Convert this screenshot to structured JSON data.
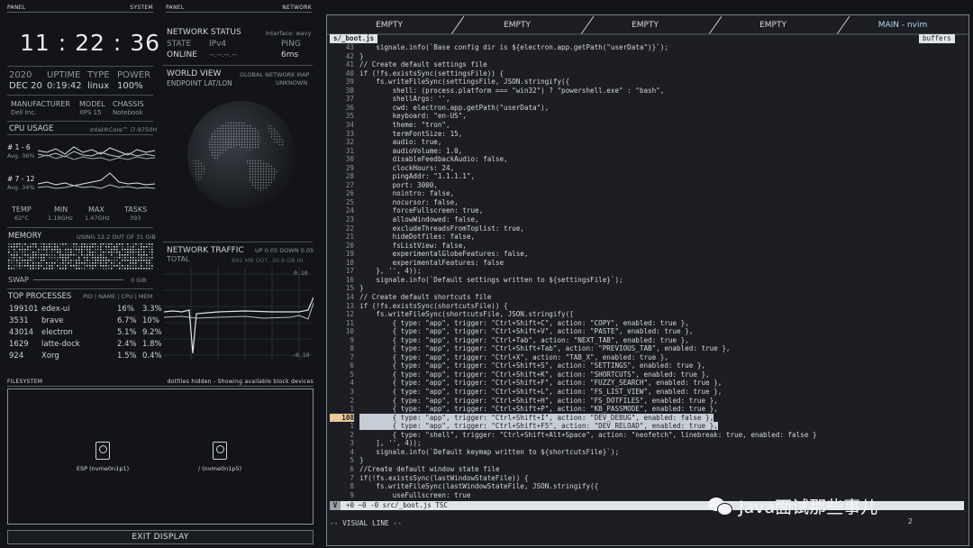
{
  "left_panel": {
    "header_left": "PANEL",
    "header_right": "SYSTEM",
    "clock": "11 : 22 : 36",
    "date_year": "2020",
    "date_day": "DEC 20",
    "uptime_label": "UPTIME",
    "uptime_value": "0:19:42",
    "type_label": "TYPE",
    "type_value": "linux",
    "power_label": "POWER",
    "power_value": "100%",
    "manufacturer_label": "MANUFACTURER",
    "manufacturer_value": "Dell Inc.",
    "model_label": "MODEL",
    "model_value": "XPS 15",
    "chassis_label": "CHASSIS",
    "chassis_value": "Notebook",
    "cpu_usage_label": "CPU USAGE",
    "cpu_model": "Intel®Core™ i7-9750H",
    "cpu_group1": "# 1 - 6",
    "cpu_group1_avg": "Avg. 36%",
    "cpu_group2": "# 7 - 12",
    "cpu_group2_avg": "Avg. 34%",
    "temp_label": "TEMP",
    "temp_value": "62°C",
    "min_label": "MIN",
    "min_value": "1.19GHz",
    "max_label": "MAX",
    "max_value": "1.47GHz",
    "tasks_label": "TASKS",
    "tasks_value": "393",
    "memory_label": "MEMORY",
    "memory_usage": "USING 12.2 OUT OF 31 GiB",
    "swap_label": "SWAP",
    "swap_value": "0 GiB",
    "top_processes_label": "TOP PROCESSES",
    "top_processes_cols": "PID | NAME | CPU | MEM",
    "processes": [
      {
        "pid": "199101",
        "name": "edex-ui",
        "cpu": "16%",
        "mem": "3.3%"
      },
      {
        "pid": "3531",
        "name": "brave",
        "cpu": "6.7%",
        "mem": "10%"
      },
      {
        "pid": "43014",
        "name": "electron",
        "cpu": "5.1%",
        "mem": "9.2%"
      },
      {
        "pid": "1629",
        "name": "latte-dock",
        "cpu": "2.4%",
        "mem": "1.8%"
      },
      {
        "pid": "924",
        "name": "Xorg",
        "cpu": "1.5%",
        "mem": "0.4%"
      }
    ]
  },
  "network_panel": {
    "header_left": "PANEL",
    "header_right": "NETWORK",
    "status_label": "NETWORK STATUS",
    "interface": "Interface: wavy",
    "state_label": "STATE",
    "ipv_label": "IPv4",
    "ping_label": "PING",
    "state_value": "ONLINE",
    "ipv_value": "--.--.--.--",
    "ping_value": "6ms",
    "world_view_label": "WORLD VIEW",
    "global_map_label": "GLOBAL NETWORK MAP",
    "endpoint_label": "ENDPOINT LAT/LON",
    "endpoint_value": "UNKNOWN",
    "traffic_label": "NETWORK TRAFFIC",
    "traffic_rate": "UP 0.05 DOWN 0.05",
    "total_label": "TOTAL",
    "total_value": "842 MB OUT, 30.9 GB IN",
    "scale_top": "0.10",
    "scale_bottom": "-0.10"
  },
  "filesystem": {
    "header_left": "FILESYSTEM",
    "header_right": "dotfiles hidden - Showing available block devices",
    "devices": [
      {
        "label": "ESP (nvme0n1p1)"
      },
      {
        "label": "/ (nvme0n1p5)"
      }
    ],
    "exit_button": "EXIT DISPLAY"
  },
  "terminal": {
    "tabs": [
      "EMPTY",
      "EMPTY",
      "EMPTY",
      "EMPTY",
      "MAIN - nvim"
    ],
    "file_tab": "s/_boot.js",
    "buffers_label": "buffers",
    "status_mode": "V",
    "status_info": "+0 ~0 -0  src/_boot.js  TSC",
    "status_right": "2",
    "command_line": "-- VISUAL LINE --",
    "watermark": "Java面试那些事儿",
    "lines": [
      {
        "n": "43",
        "t": "    signale.info(`Base config dir is ${electron.app.getPath(\"userData\")}`);"
      },
      {
        "n": "42",
        "t": "}"
      },
      {
        "n": "41",
        "t": "// Create default settings file"
      },
      {
        "n": "40",
        "t": "if (!fs.existsSync(settingsFile)) {"
      },
      {
        "n": "39",
        "t": "    fs.writeFileSync(settingsFile, JSON.stringify({"
      },
      {
        "n": "38",
        "t": "        shell: (process.platform === \"win32\") ? \"powershell.exe\" : \"bash\","
      },
      {
        "n": "37",
        "t": "        shellArgs: '',"
      },
      {
        "n": "36",
        "t": "        cwd: electron.app.getPath(\"userData\"),"
      },
      {
        "n": "35",
        "t": "        keyboard: \"en-US\","
      },
      {
        "n": "34",
        "t": "        theme: \"tron\","
      },
      {
        "n": "33",
        "t": "        termFontSize: 15,"
      },
      {
        "n": "32",
        "t": "        audio: true,"
      },
      {
        "n": "31",
        "t": "        audioVolume: 1.0,"
      },
      {
        "n": "30",
        "t": "        disableFeedbackAudio: false,"
      },
      {
        "n": "29",
        "t": "        clockHours: 24,"
      },
      {
        "n": "28",
        "t": "        pingAddr: \"1.1.1.1\","
      },
      {
        "n": "27",
        "t": "        port: 3000,"
      },
      {
        "n": "26",
        "t": "        nointro: false,"
      },
      {
        "n": "25",
        "t": "        nocursor: false,"
      },
      {
        "n": "24",
        "t": "        forceFullscreen: true,"
      },
      {
        "n": "23",
        "t": "        allowWindowed: false,"
      },
      {
        "n": "22",
        "t": "        excludeThreadsFromToplist: true,"
      },
      {
        "n": "21",
        "t": "        hideDotfiles: false,"
      },
      {
        "n": "20",
        "t": "        fsListView: false,"
      },
      {
        "n": "19",
        "t": "        experimentalGlobeFeatures: false,"
      },
      {
        "n": "18",
        "t": "        experimentalFeatures: false"
      },
      {
        "n": "17",
        "t": "    }, '', 4));"
      },
      {
        "n": "16",
        "t": "    signale.info(`Default settings written to ${settingsFile}`);"
      },
      {
        "n": "15",
        "t": "}"
      },
      {
        "n": "14",
        "t": "// Create default shortcuts file"
      },
      {
        "n": "13",
        "t": "if (!fs.existsSync(shortcutsFile)) {"
      },
      {
        "n": "12",
        "t": "    fs.writeFileSync(shortcutsFile, JSON.stringify(["
      },
      {
        "n": "11",
        "t": "        { type: \"app\", trigger: \"Ctrl+Shift+C\", action: \"COPY\", enabled: true },"
      },
      {
        "n": "10",
        "t": "        { type: \"app\", trigger: \"Ctrl+Shift+V\", action: \"PASTE\", enabled: true },"
      },
      {
        "n": "9",
        "t": "        { type: \"app\", trigger: \"Ctrl+Tab\", action: \"NEXT_TAB\", enabled: true },"
      },
      {
        "n": "8",
        "t": "        { type: \"app\", trigger: \"Ctrl+Shift+Tab\", action: \"PREVIOUS_TAB\", enabled: true },"
      },
      {
        "n": "7",
        "t": "        { type: \"app\", trigger: \"Ctrl+X\", action: \"TAB_X\", enabled: true },"
      },
      {
        "n": "6",
        "t": "        { type: \"app\", trigger: \"Ctrl+Shift+S\", action: \"SETTINGS\", enabled: true },"
      },
      {
        "n": "5",
        "t": "        { type: \"app\", trigger: \"Ctrl+Shift+K\", action: \"SHORTCUTS\", enabled: true },"
      },
      {
        "n": "4",
        "t": "        { type: \"app\", trigger: \"Ctrl+Shift+F\", action: \"FUZZY_SEARCH\", enabled: true },"
      },
      {
        "n": "3",
        "t": "        { type: \"app\", trigger: \"Ctrl+Shift+L\", action: \"FS_LIST_VIEW\", enabled: true },"
      },
      {
        "n": "2",
        "t": "        { type: \"app\", trigger: \"Ctrl+Shift+H\", action: \"FS_DOTFILES\", enabled: true },"
      },
      {
        "n": "1",
        "t": "        { type: \"app\", trigger: \"Ctrl+Shift+P\", action: \"KB_PASSMODE\", enabled: true },"
      },
      {
        "n": "108",
        "t": "        { type: \"app\", trigger: \"Ctrl+Shift+I\", action: \"DEV_DEBUG\", enabled: false },",
        "current": true
      },
      {
        "n": "1",
        "t": "        { type: \"app\", trigger: \"Ctrl+Shift+F5\", action: \"DEV_RELOAD\", enabled: true },",
        "selected": true
      },
      {
        "n": "2",
        "t": "        { type: \"shell\", trigger: \"Ctrl+Shift+Alt+Space\", action: \"neofetch\", linebreak: true, enabled: false }"
      },
      {
        "n": "3",
        "t": "    ], '', 4));"
      },
      {
        "n": "4",
        "t": "    signale.info(`Default keymap written to ${shortcutsFile}`);"
      },
      {
        "n": "5",
        "t": "}"
      },
      {
        "n": "6",
        "t": "//Create default window state file"
      },
      {
        "n": "7",
        "t": "if(!fs.existsSync(lastWindowStateFile)) {"
      },
      {
        "n": "8",
        "t": "    fs.writeFileSync(lastWindowStateFile, JSON.stringify({"
      },
      {
        "n": "9",
        "t": "        useFullscreen: true"
      }
    ]
  },
  "colors": {
    "background": "#121419",
    "panel_border": "#5a5e66",
    "terminal_bg": "#1c1e24",
    "tab_active": "#b3d9e8",
    "highlight_line": "#c7cdd6",
    "current_line_number": "#e8c99a"
  }
}
